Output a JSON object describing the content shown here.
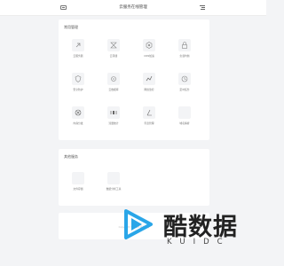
{
  "header": {
    "title": "云服务在线管理",
    "left_icon": "back-window-icon",
    "right_icon": "menu-icon"
  },
  "main_card": {
    "title": "常用管理",
    "items": [
      {
        "label": "云服务器",
        "icon": "server-icon"
      },
      {
        "label": "云存储",
        "icon": "storage-icon"
      },
      {
        "label": "CDN加速",
        "icon": "cdn-icon"
      },
      {
        "label": "负载均衡",
        "icon": "lock-icon"
      },
      {
        "label": "安全防护",
        "icon": "shield-icon"
      },
      {
        "label": "云数据库",
        "icon": "database-icon"
      },
      {
        "label": "网络监控",
        "icon": "network-icon"
      },
      {
        "label": "定时任务",
        "icon": "clock-icon"
      },
      {
        "label": "内容分发",
        "icon": "distribute-icon"
      },
      {
        "label": "流量统计",
        "icon": "traffic-icon"
      },
      {
        "label": "带宽管理",
        "icon": "bandwidth-icon"
      },
      {
        "label": "域名解析",
        "icon": "domain-icon"
      }
    ]
  },
  "second_card": {
    "title": "其他服务",
    "items": [
      {
        "label": "文件存储",
        "icon": "file-icon"
      },
      {
        "label": "数据分析工具",
        "icon": "analytics-icon"
      }
    ]
  },
  "footer": {
    "text": "Copyright © 2023 版权所有"
  },
  "watermark": {
    "cn": "酷数据",
    "en": "KUIDC"
  },
  "colors": {
    "background": "#f3f4f6",
    "card": "#ffffff",
    "watermark_blue": "#2aa6e8"
  }
}
